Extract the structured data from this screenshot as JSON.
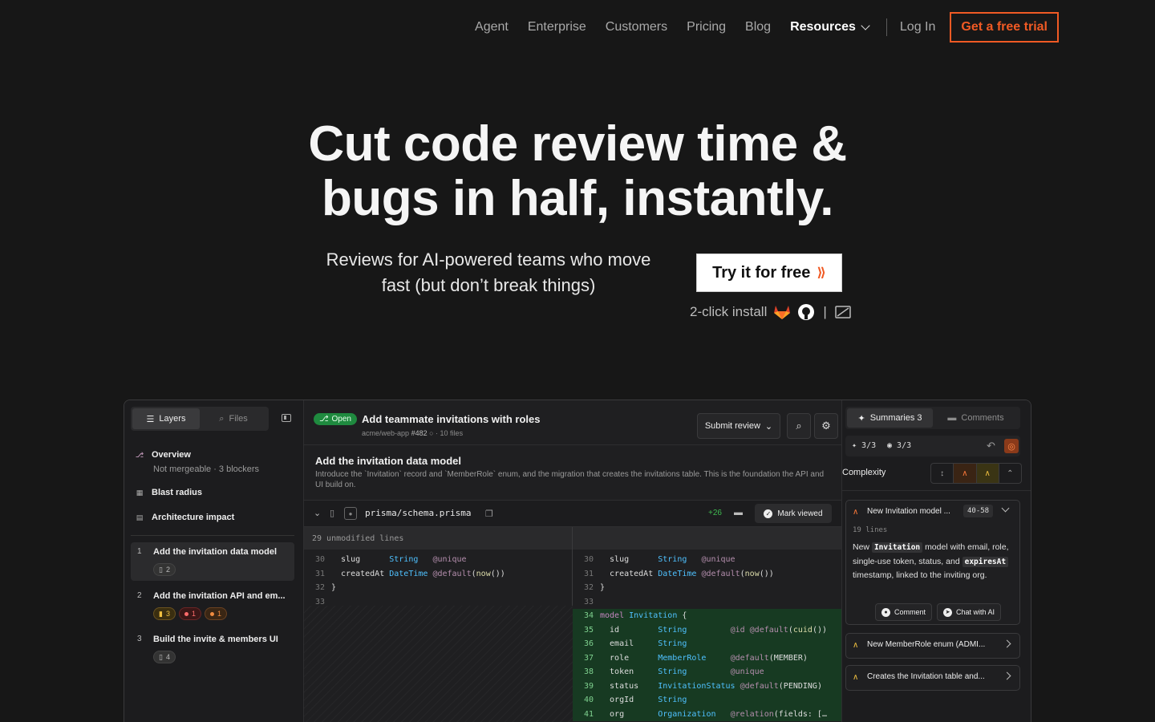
{
  "nav": {
    "items": [
      "Agent",
      "Enterprise",
      "Customers",
      "Pricing",
      "Blog"
    ],
    "resources": "Resources",
    "login": "Log In",
    "cta": "Get a free trial"
  },
  "hero": {
    "title_line1": "Cut code review time &",
    "title_line2": "bugs in half, instantly.",
    "subtitle_line1": "Reviews for AI-powered teams who move",
    "subtitle_line2": "fast (but don’t break things)",
    "try_button": "Try it for free",
    "install_text": "2-click install",
    "install_sep": "|"
  },
  "app": {
    "left": {
      "tab_layers": "Layers",
      "tab_files": "Files",
      "overview": "Overview",
      "overview_sub": "Not mergeable · 3 blockers",
      "blast_radius": "Blast radius",
      "architecture": "Architecture impact",
      "steps": [
        {
          "num": "1",
          "title": "Add the invitation data model",
          "chips": [
            {
              "type": "file",
              "text": "2"
            }
          ]
        },
        {
          "num": "2",
          "title": "Add the invitation API and em...",
          "chips": [
            {
              "type": "yel",
              "text": "3"
            },
            {
              "type": "red",
              "text": "1"
            },
            {
              "type": "org",
              "text": "1"
            }
          ]
        },
        {
          "num": "3",
          "title": "Build the invite & members UI",
          "chips": [
            {
              "type": "file",
              "text": "4"
            }
          ]
        }
      ]
    },
    "pr": {
      "status": "Open",
      "title": "Add teammate invitations with roles",
      "repo": "acme/web-app",
      "number": "#482",
      "files": "10 files",
      "submit": "Submit review"
    },
    "section": {
      "title": "Add the invitation data model",
      "desc": "Introduce the `Invitation` record and `MemberRole` enum, and the migration that creates the invitations table. This is the foundation the API and UI build on."
    },
    "file": {
      "name": "prisma/schema.prisma",
      "additions": "+26",
      "mark_viewed": "Mark viewed",
      "unmodified": "29 unmodified lines"
    },
    "diff_left": [
      {
        "ln": "30",
        "code": "  slug      String   @unique"
      },
      {
        "ln": "31",
        "code": "  createdAt DateTime @default(now())"
      },
      {
        "ln": "32",
        "code": "}"
      },
      {
        "ln": "33",
        "code": ""
      }
    ],
    "diff_right": [
      {
        "ln": "30",
        "code": "  slug      String   @unique",
        "add": false
      },
      {
        "ln": "31",
        "code": "  createdAt DateTime @default(now())",
        "add": false
      },
      {
        "ln": "32",
        "code": "}",
        "add": false
      },
      {
        "ln": "33",
        "code": "",
        "add": false
      },
      {
        "ln": "34",
        "code": "model Invitation {",
        "add": true
      },
      {
        "ln": "35",
        "code": "  id        String         @id @default(cuid())",
        "add": true
      },
      {
        "ln": "36",
        "code": "  email     String",
        "add": true
      },
      {
        "ln": "37",
        "code": "  role      MemberRole     @default(MEMBER)",
        "add": true
      },
      {
        "ln": "38",
        "code": "  token     String         @unique",
        "add": true
      },
      {
        "ln": "39",
        "code": "  status    InvitationStatus @default(PENDING)",
        "add": true
      },
      {
        "ln": "40",
        "code": "  orgId     String",
        "add": true
      },
      {
        "ln": "41",
        "code": "  org       Organization   @relation(fields: […",
        "add": true
      }
    ],
    "right": {
      "tab_summaries": "Summaries 3",
      "tab_comments": "Comments",
      "stat_a": "3/3",
      "stat_b": "3/3",
      "complexity": "Complexity",
      "card1": {
        "title": "New Invitation model ...",
        "lines": "40-58",
        "meta": "19 lines",
        "body_1": "New",
        "code_1": "Invitation",
        "body_2": "model with email, role, single-use token, status, and",
        "code_2": "expiresAt",
        "body_3": "timestamp, linked to the inviting org.",
        "comment": "Comment",
        "chat": "Chat with AI"
      },
      "card2": {
        "title": "New MemberRole enum (ADMI..."
      },
      "card3": {
        "title": "Creates the Invitation table and..."
      }
    }
  },
  "colors": {
    "accent": "#f05a24",
    "bg": "#171717",
    "add_bg": "#173a22",
    "open": "#1f8a3f"
  }
}
